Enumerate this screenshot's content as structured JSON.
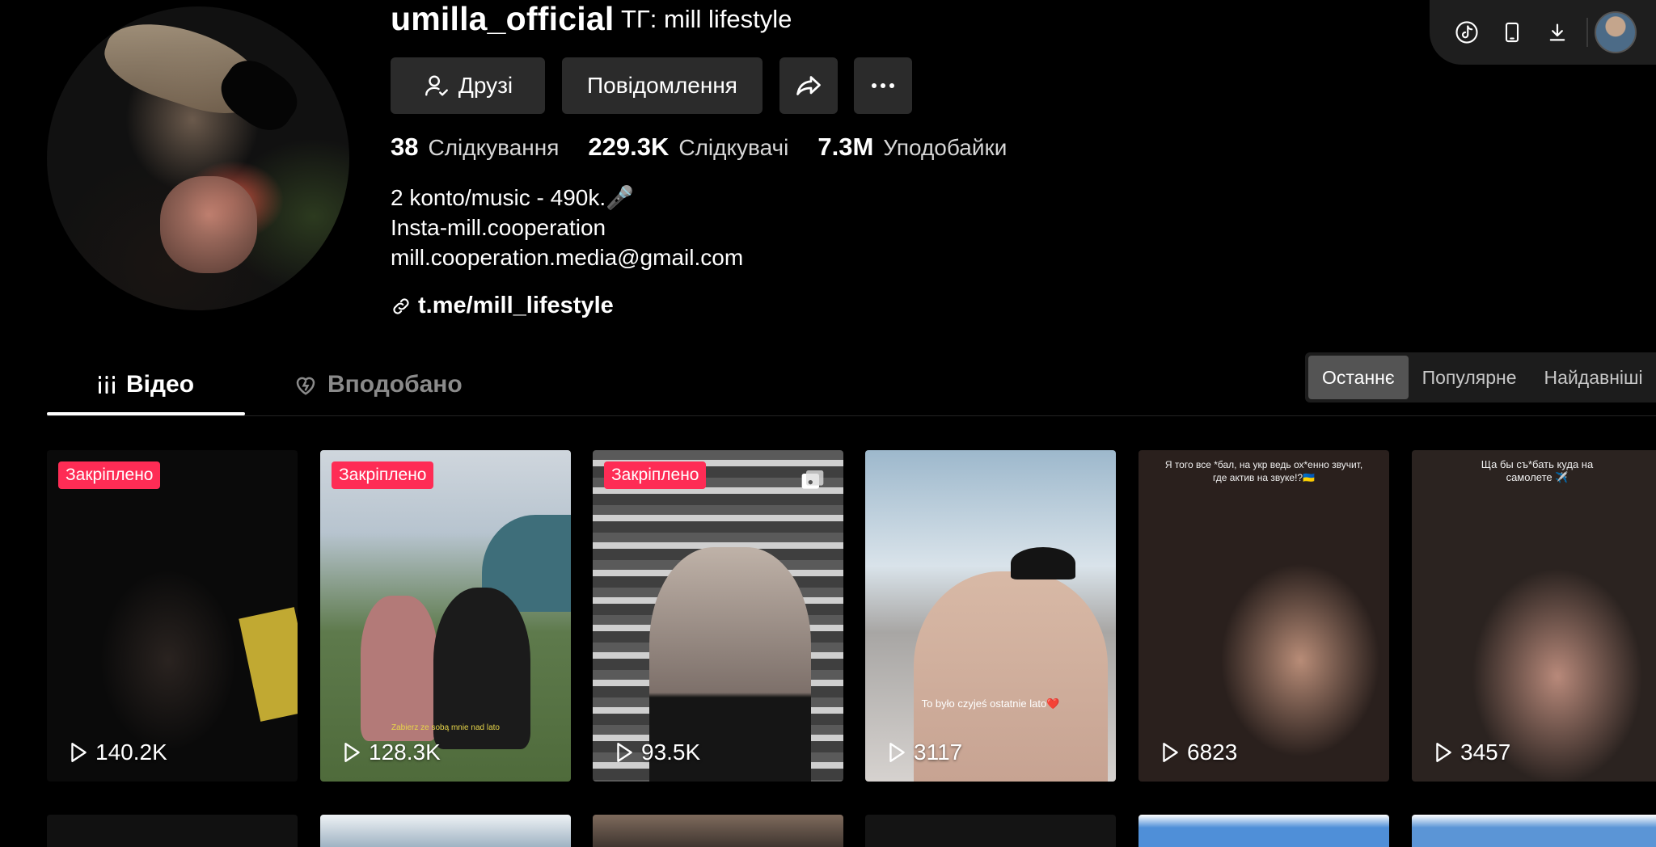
{
  "profile": {
    "username": "umilla_official",
    "nickname": "ТГ: mill lifestyle",
    "buttons": {
      "friends": "Друзі",
      "message": "Повідомлення"
    },
    "stats": [
      {
        "value": "38",
        "label": "Слідкування"
      },
      {
        "value": "229.3K",
        "label": "Слідкувачі"
      },
      {
        "value": "7.3M",
        "label": "Уподобайки"
      }
    ],
    "bio": [
      "2 konto/music - 490k.🎤",
      "Insta-mill.cooperation",
      "mill.cooperation.media@gmail.com"
    ],
    "link": "t.me/mill_lifestyle"
  },
  "toolbar": {
    "icons": [
      "tiktok-icon",
      "phone-icon",
      "download-icon"
    ]
  },
  "tabs": [
    {
      "label": "Відео",
      "icon": "grid-icon",
      "active": true
    },
    {
      "label": "Вподобано",
      "icon": "heart-icon",
      "active": false
    }
  ],
  "sort": {
    "options": [
      "Останнє",
      "Популярне",
      "Найдавніші"
    ],
    "selected": "Останнє"
  },
  "videos": [
    {
      "pinned": "Закріплено",
      "views": "140.2K"
    },
    {
      "pinned": "Закріплено",
      "views": "128.3K",
      "caption": "Zabierz ze sobą mnie nad lato"
    },
    {
      "pinned": "Закріплено",
      "views": "93.5K",
      "icon": "photo-icon"
    },
    {
      "views": "3117",
      "caption": "To było czyjeś ostatnie lato❤️"
    },
    {
      "views": "6823",
      "caption": "Я того все *бал, на укр ведь ох*енно звучит, где актив на звуке!?🇺🇦"
    },
    {
      "views": "3457",
      "caption": "Ща бы съ*бать куда на самолете ✈️"
    }
  ],
  "colors": {
    "background": "#000000",
    "pinned_badge": "#fe2c55",
    "button": "#2b2b2b"
  }
}
